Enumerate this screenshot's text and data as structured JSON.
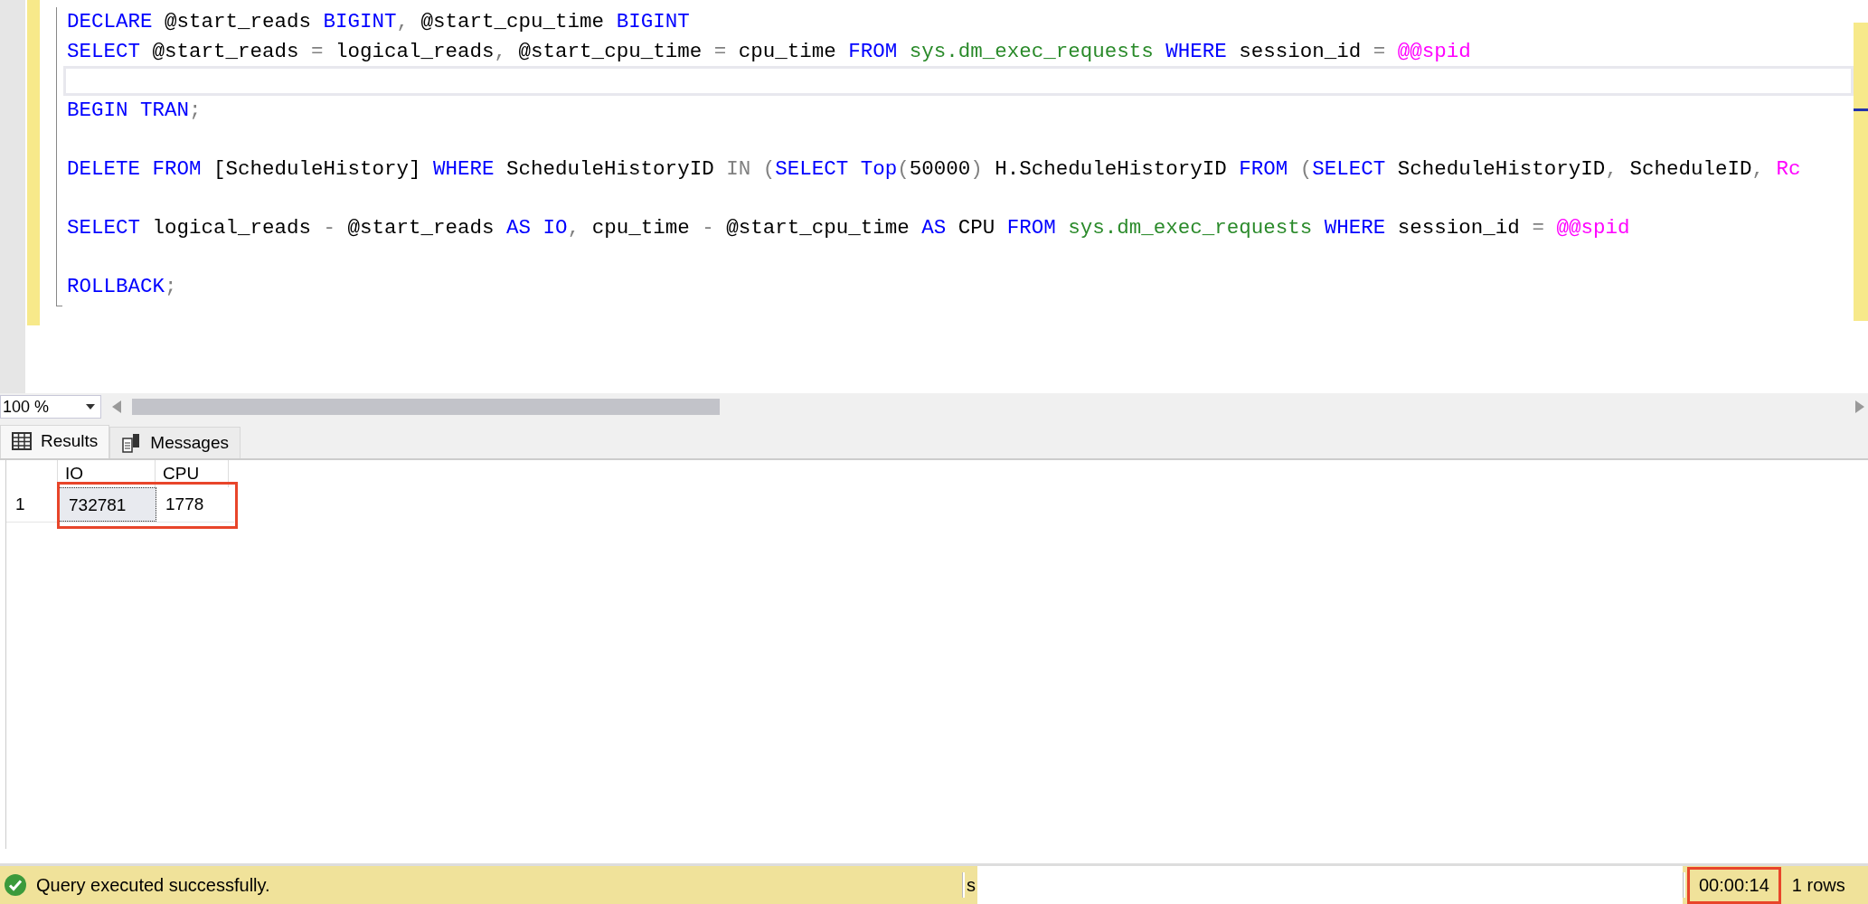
{
  "editor": {
    "lines": [
      {
        "current": false,
        "tokens": [
          {
            "kind": "keyword",
            "text": "DECLARE"
          },
          {
            "kind": "plain",
            "text": " @start_reads "
          },
          {
            "kind": "keyword",
            "text": "BIGINT"
          },
          {
            "kind": "operator",
            "text": ","
          },
          {
            "kind": "plain",
            "text": " @start_cpu_time "
          },
          {
            "kind": "keyword",
            "text": "BIGINT"
          }
        ]
      },
      {
        "current": false,
        "tokens": [
          {
            "kind": "keyword",
            "text": "SELECT"
          },
          {
            "kind": "plain",
            "text": " @start_reads "
          },
          {
            "kind": "operator",
            "text": "="
          },
          {
            "kind": "plain",
            "text": " logical_reads"
          },
          {
            "kind": "operator",
            "text": ","
          },
          {
            "kind": "plain",
            "text": " @start_cpu_time "
          },
          {
            "kind": "operator",
            "text": "="
          },
          {
            "kind": "plain",
            "text": " cpu_time "
          },
          {
            "kind": "keyword",
            "text": "FROM "
          },
          {
            "kind": "system",
            "text": "sys.dm_exec_requests "
          },
          {
            "kind": "keyword",
            "text": "WHERE"
          },
          {
            "kind": "plain",
            "text": " session_id "
          },
          {
            "kind": "operator",
            "text": "= "
          },
          {
            "kind": "variable",
            "text": "@@spid"
          }
        ]
      },
      {
        "current": true
      },
      {
        "current": false,
        "tokens": [
          {
            "kind": "keyword",
            "text": "BEGIN TRAN"
          },
          {
            "kind": "operator",
            "text": ";"
          }
        ]
      },
      {
        "current": false
      },
      {
        "current": false,
        "tokens": [
          {
            "kind": "keyword",
            "text": "DELETE FROM"
          },
          {
            "kind": "plain",
            "text": " [ScheduleHistory] "
          },
          {
            "kind": "keyword",
            "text": "WHERE"
          },
          {
            "kind": "plain",
            "text": " ScheduleHistoryID "
          },
          {
            "kind": "operator",
            "text": "IN ("
          },
          {
            "kind": "keyword",
            "text": "SELECT Top"
          },
          {
            "kind": "operator",
            "text": "("
          },
          {
            "kind": "plain",
            "text": "50000"
          },
          {
            "kind": "operator",
            "text": ")"
          },
          {
            "kind": "plain",
            "text": " H.ScheduleHistoryID "
          },
          {
            "kind": "keyword",
            "text": "FROM "
          },
          {
            "kind": "operator",
            "text": "("
          },
          {
            "kind": "keyword",
            "text": "SELECT"
          },
          {
            "kind": "plain",
            "text": " ScheduleHistoryID"
          },
          {
            "kind": "operator",
            "text": ","
          },
          {
            "kind": "plain",
            "text": " ScheduleID"
          },
          {
            "kind": "operator",
            "text": ", "
          },
          {
            "kind": "variable",
            "text": "Rc"
          }
        ]
      },
      {
        "current": false
      },
      {
        "current": false,
        "tokens": [
          {
            "kind": "keyword",
            "text": "SELECT"
          },
          {
            "kind": "plain",
            "text": " logical_reads "
          },
          {
            "kind": "operator",
            "text": "-"
          },
          {
            "kind": "plain",
            "text": " @start_reads "
          },
          {
            "kind": "keyword",
            "text": "AS IO"
          },
          {
            "kind": "operator",
            "text": ","
          },
          {
            "kind": "plain",
            "text": " cpu_time "
          },
          {
            "kind": "operator",
            "text": "-"
          },
          {
            "kind": "plain",
            "text": " @start_cpu_time "
          },
          {
            "kind": "keyword",
            "text": "AS"
          },
          {
            "kind": "plain",
            "text": " CPU "
          },
          {
            "kind": "keyword",
            "text": "FROM "
          },
          {
            "kind": "system",
            "text": "sys.dm_exec_requests "
          },
          {
            "kind": "keyword",
            "text": "WHERE"
          },
          {
            "kind": "plain",
            "text": " session_id "
          },
          {
            "kind": "operator",
            "text": "= "
          },
          {
            "kind": "variable",
            "text": "@@spid"
          }
        ]
      },
      {
        "current": false
      },
      {
        "current": false,
        "tokens": [
          {
            "kind": "keyword",
            "text": "ROLLBACK"
          },
          {
            "kind": "operator",
            "text": ";"
          }
        ]
      }
    ],
    "zoom": "100 %"
  },
  "results": {
    "tabs": [
      {
        "label": "Results",
        "selected": true
      },
      {
        "label": "Messages",
        "selected": false
      }
    ],
    "columns": [
      "IO",
      "CPU"
    ],
    "rows": [
      {
        "number": "1",
        "cells": [
          "732781",
          "1778"
        ]
      }
    ]
  },
  "status_bar": {
    "message": "Query executed successfully.",
    "server": "s",
    "elapsed": "00:00:14",
    "rows": "1 rows"
  }
}
